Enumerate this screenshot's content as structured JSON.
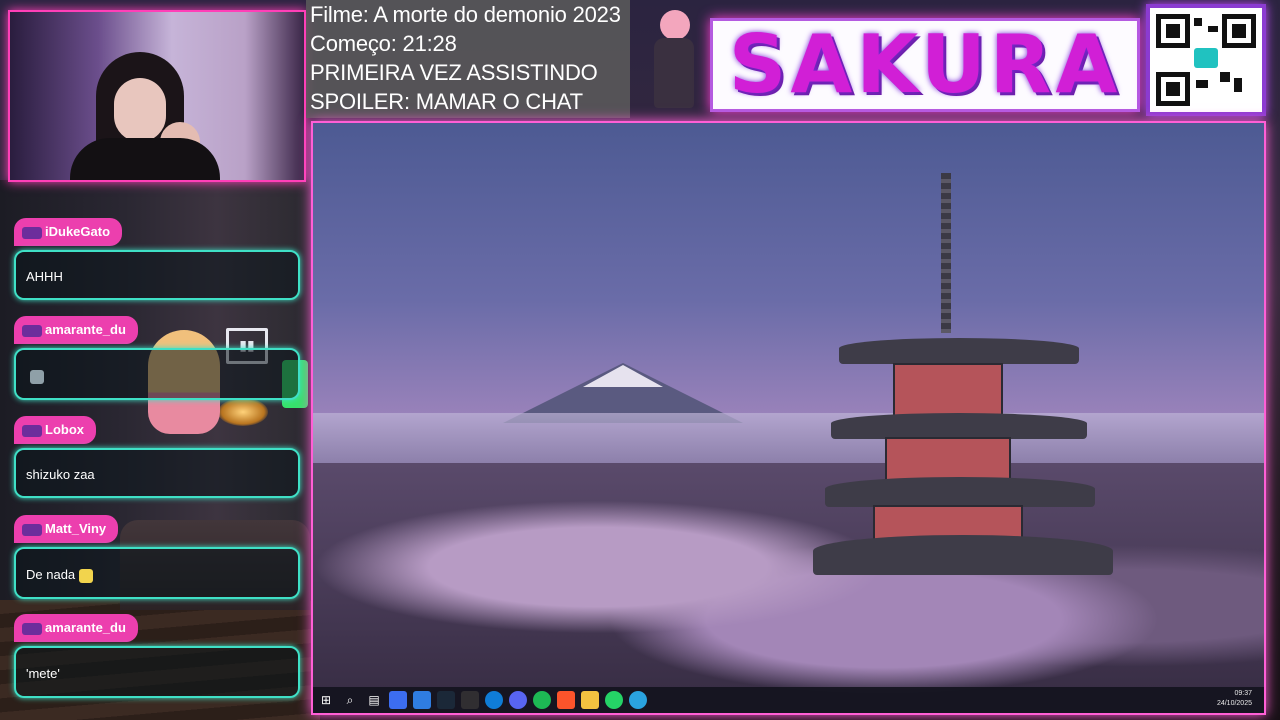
{
  "stream_info": {
    "line1": "Filme: A morte do demonio 2023",
    "line2": "Começo: 21:28",
    "line3": "PRIMEIRA VEZ ASSISTINDO",
    "line4": "SPOILER: MAMAR O CHAT"
  },
  "logo": {
    "text": "SAKURA"
  },
  "colors": {
    "neon_pink": "#ff3fb8",
    "username_tag": "#ec3fae",
    "bubble_border": "#3fe0c6",
    "logo_purple": "#d11fd6"
  },
  "chat": {
    "messages": [
      {
        "user": "iDukeGato",
        "text": "AHHH"
      },
      {
        "user": "amarante_du",
        "text": ""
      },
      {
        "user": "Lobox",
        "text": "shizuko zaa"
      },
      {
        "user": "Matt_Viny",
        "text": "De nada"
      },
      {
        "user": "amarante_du",
        "text": "'mete'"
      }
    ]
  },
  "taskbar": {
    "icons": [
      "windows-start-icon",
      "search-icon",
      "task-view-icon",
      "widgets-icon",
      "store-icon",
      "steam-icon",
      "obs-icon",
      "edge-icon",
      "discord-icon",
      "spotify-icon",
      "brave-icon",
      "file-explorer-icon",
      "whatsapp-icon",
      "telegram-icon"
    ],
    "time": "09:37",
    "date": "24/10/2025"
  }
}
